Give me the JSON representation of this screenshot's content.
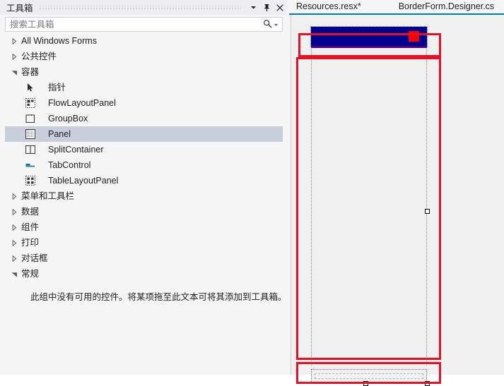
{
  "toolbox": {
    "title": "工具箱",
    "header_buttons": [
      {
        "name": "dropdown",
        "label": "▾"
      },
      {
        "name": "pin",
        "label": "pin"
      },
      {
        "name": "close",
        "label": "✕"
      }
    ],
    "search": {
      "placeholder": "搜索工具箱",
      "value": "",
      "icon": "search-icon",
      "caret": "chevron-down-icon"
    },
    "tree": [
      {
        "label": "All Windows Forms",
        "type": "group",
        "expanded": false
      },
      {
        "label": "公共控件",
        "type": "group",
        "expanded": false
      },
      {
        "label": "容器",
        "type": "group",
        "expanded": true
      },
      {
        "label": "指针",
        "type": "leaf",
        "icon": "pointer-icon",
        "selected": false
      },
      {
        "label": "FlowLayoutPanel",
        "type": "leaf",
        "icon": "flowlayoutpanel-icon",
        "selected": false
      },
      {
        "label": "GroupBox",
        "type": "leaf",
        "icon": "groupbox-icon",
        "selected": false
      },
      {
        "label": "Panel",
        "type": "leaf",
        "icon": "panel-icon",
        "selected": true
      },
      {
        "label": "SplitContainer",
        "type": "leaf",
        "icon": "splitcontainer-icon",
        "selected": false
      },
      {
        "label": "TabControl",
        "type": "leaf",
        "icon": "tabcontrol-icon",
        "selected": false
      },
      {
        "label": "TableLayoutPanel",
        "type": "leaf",
        "icon": "tablelayoutpanel-icon",
        "selected": false
      },
      {
        "label": "菜单和工具栏",
        "type": "group",
        "expanded": false
      },
      {
        "label": "数据",
        "type": "group",
        "expanded": false
      },
      {
        "label": "组件",
        "type": "group",
        "expanded": false
      },
      {
        "label": "打印",
        "type": "group",
        "expanded": false
      },
      {
        "label": "对话框",
        "type": "group",
        "expanded": false
      },
      {
        "label": "常规",
        "type": "group",
        "expanded": true
      }
    ],
    "empty_group_note": "此组中没有可用的控件。将某项拖至此文本可将其添加到工具箱。"
  },
  "designer": {
    "tabs": [
      {
        "label": "Resources.resx*",
        "active": false
      },
      {
        "label": "BorderForm.Designer.cs",
        "active": true
      }
    ],
    "accent_color": "#007acc",
    "surface": {
      "background": "#f0f0f0",
      "top_panel": {
        "name": "top-blue-panel",
        "color": "#00008f",
        "underline_color": "#4b0082",
        "badge": {
          "name": "red-square",
          "color": "#fb0000"
        }
      },
      "center_panel": {
        "name": "center-panel",
        "color": "#f0f0f0"
      },
      "bottom_panel": {
        "name": "bottom-panel-selected",
        "color": "#f0f0f0",
        "selected": true
      }
    },
    "annotations": [
      {
        "name": "annotation-top",
        "color": "#e81123"
      },
      {
        "name": "annotation-middle",
        "color": "#e81123"
      },
      {
        "name": "annotation-bottom",
        "color": "#e81123"
      }
    ],
    "handles": [
      {
        "name": "handle-right-middle"
      },
      {
        "name": "handle-bottom-center"
      },
      {
        "name": "handle-bottom-right"
      }
    ]
  }
}
